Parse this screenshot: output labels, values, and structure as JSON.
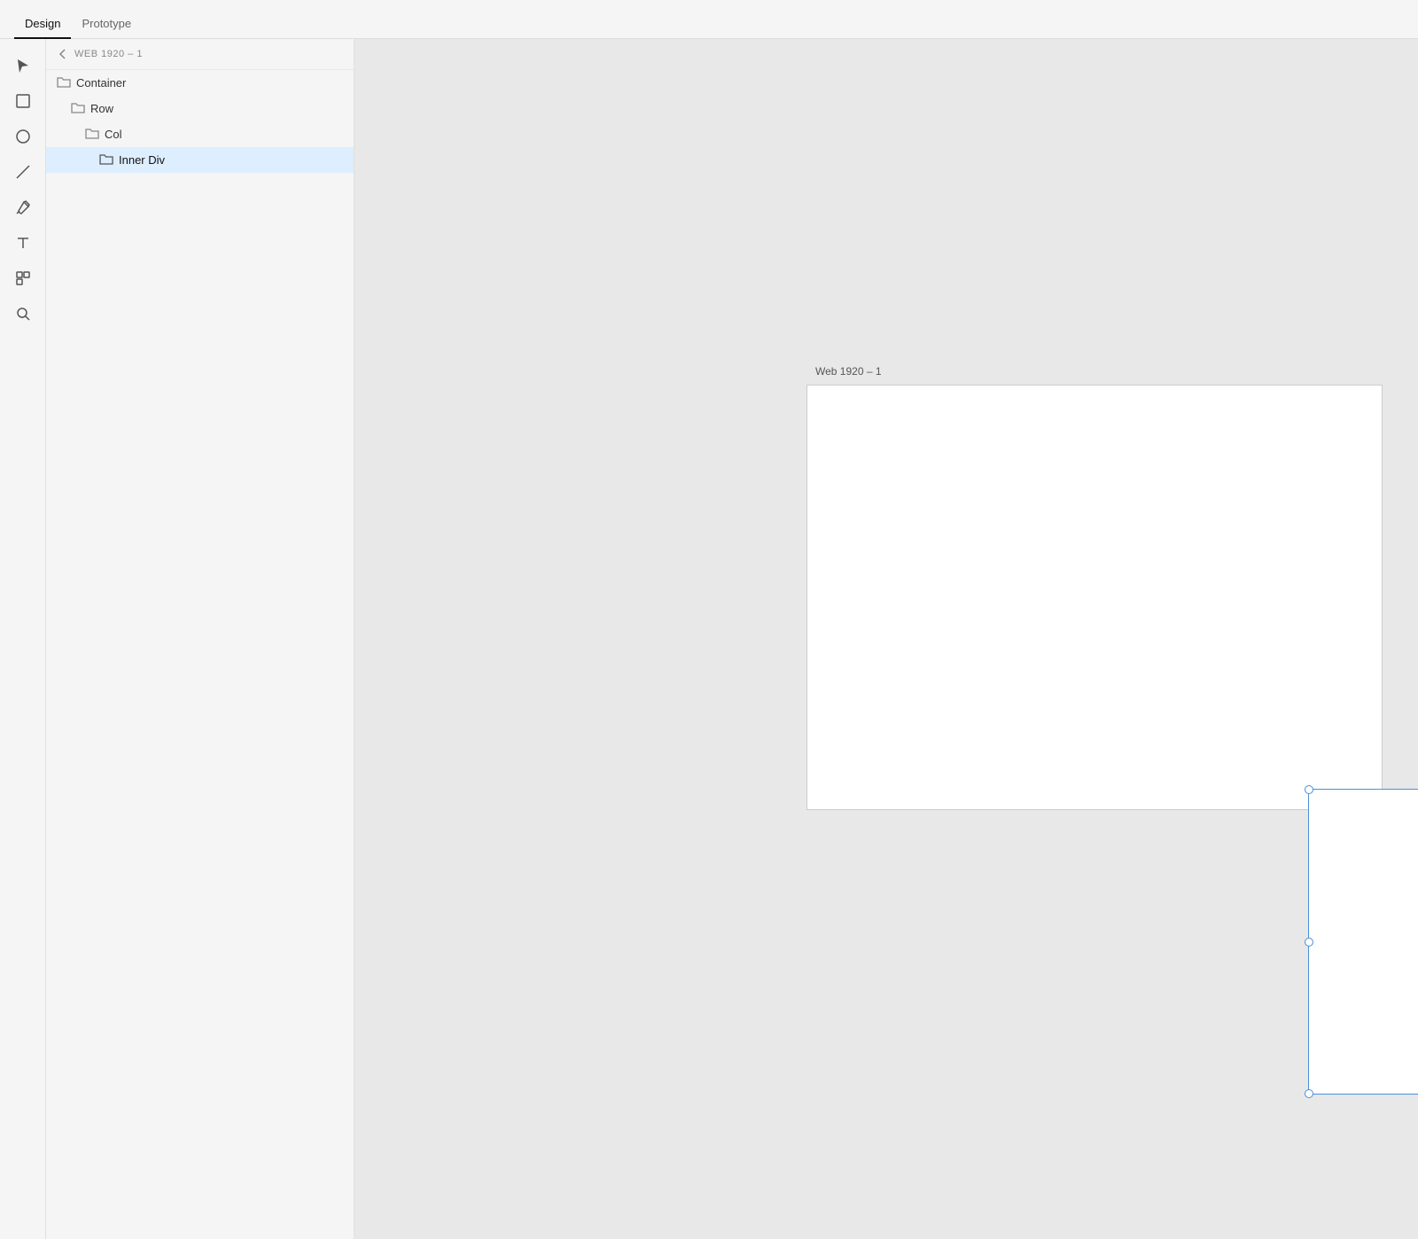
{
  "header": {
    "tabs": [
      {
        "id": "design",
        "label": "Design",
        "active": true
      },
      {
        "id": "prototype",
        "label": "Prototype",
        "active": false
      }
    ]
  },
  "toolbar": {
    "icons": [
      {
        "id": "pointer",
        "name": "pointer-tool",
        "unicode": "▶"
      },
      {
        "id": "frame",
        "name": "frame-tool",
        "unicode": "□"
      },
      {
        "id": "ellipse",
        "name": "ellipse-tool",
        "unicode": "○"
      },
      {
        "id": "line",
        "name": "line-tool",
        "unicode": "/"
      },
      {
        "id": "pen",
        "name": "pen-tool",
        "unicode": "✒"
      },
      {
        "id": "text",
        "name": "text-tool",
        "unicode": "T"
      },
      {
        "id": "component",
        "name": "component-tool",
        "unicode": "⊞"
      },
      {
        "id": "search",
        "name": "search-tool",
        "unicode": "🔍"
      }
    ]
  },
  "layers_panel": {
    "breadcrumb": "WEB 1920 – 1",
    "items": [
      {
        "id": "container",
        "label": "Container",
        "indent": 0,
        "selected": false
      },
      {
        "id": "row",
        "label": "Row",
        "indent": 1,
        "selected": false
      },
      {
        "id": "col",
        "label": "Col",
        "indent": 2,
        "selected": false
      },
      {
        "id": "inner-div",
        "label": "Inner Div",
        "indent": 3,
        "selected": true
      }
    ]
  },
  "canvas": {
    "frame_label": "Web 1920 – 1"
  }
}
